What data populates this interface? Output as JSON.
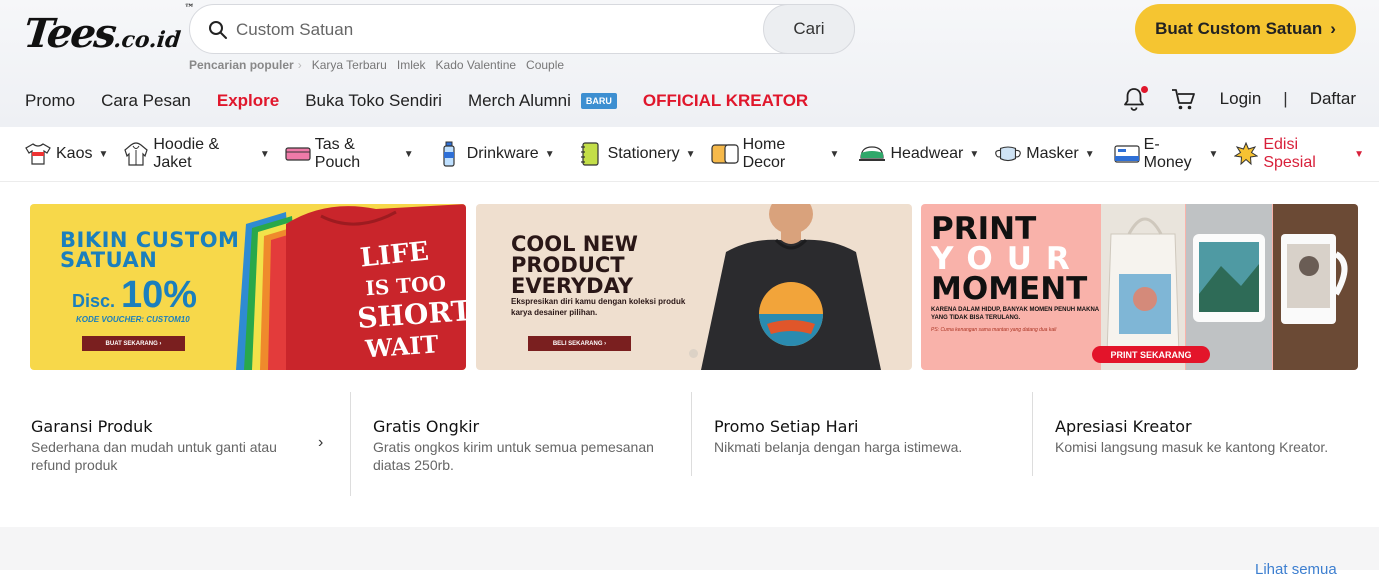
{
  "brand": {
    "logo_main": "Tees",
    "logo_suffix": ".co.id",
    "logo_tm": "™"
  },
  "search": {
    "placeholder": "Custom Satuan",
    "button": "Cari"
  },
  "popular": {
    "label": "Pencarian populer",
    "items": [
      "Karya Terbaru",
      "Imlek",
      "Kado Valentine",
      "Couple"
    ]
  },
  "cta": {
    "label": "Buat Custom Satuan",
    "arrow": "›"
  },
  "nav": {
    "items": [
      {
        "label": "Promo"
      },
      {
        "label": "Cara Pesan"
      },
      {
        "label": "Explore"
      },
      {
        "label": "Buka Toko Sendiri"
      },
      {
        "label": "Merch Alumni",
        "badge": "BARU"
      },
      {
        "label": "OFFICIAL KREATOR"
      }
    ],
    "login": "Login",
    "separator": "|",
    "register": "Daftar"
  },
  "categories": [
    {
      "label": "Kaos",
      "icon": "tshirt-icon"
    },
    {
      "label": "Hoodie & Jaket",
      "icon": "hoodie-icon"
    },
    {
      "label": "Tas & Pouch",
      "icon": "pouch-icon"
    },
    {
      "label": "Drinkware",
      "icon": "bottle-icon"
    },
    {
      "label": "Stationery",
      "icon": "notebook-icon"
    },
    {
      "label": "Home Decor",
      "icon": "pillow-icon"
    },
    {
      "label": "Headwear",
      "icon": "cap-icon"
    },
    {
      "label": "Masker",
      "icon": "mask-icon"
    },
    {
      "label": "E-Money",
      "icon": "card-icon"
    },
    {
      "label": "Edisi Spesial",
      "icon": "star-burst-icon"
    }
  ],
  "banners": {
    "b1": {
      "title_1": "BIKIN CUSTOM",
      "title_2": "SATUAN",
      "disc_label": "Disc.",
      "disc_value": "10%",
      "voucher": "KODE VOUCHER: CUSTOM10",
      "button": "BUAT SEKARANG ›",
      "shirt_text": "LIFE IS TOO SHORT TO WAIT"
    },
    "b2": {
      "title_1": "COOL NEW",
      "title_2": "PRODUCT",
      "title_3": "EVERYDAY",
      "sub": "Ekspresikan diri kamu dengan koleksi produk karya desainer pilihan.",
      "button": "BELI SEKARANG ›"
    },
    "b3": {
      "title_1": "PRINT",
      "title_2": "YOUR",
      "title_3": "MOMENT",
      "sub": "KARENA DALAM HIDUP, BANYAK MOMEN PENUH MAKNA YANG TIDAK BISA TERULANG.",
      "ps": "PS: Cuma kenangan sama mantan yang datang dua kali",
      "button": "PRINT SEKARANG"
    }
  },
  "features": [
    {
      "title": "Garansi Produk",
      "desc": "Sederhana dan mudah untuk ganti atau refund produk"
    },
    {
      "title": "Gratis Ongkir",
      "desc": "Gratis ongkos kirim untuk semua pemesanan diatas 250rb."
    },
    {
      "title": "Promo Setiap Hari",
      "desc": "Nikmati belanja dengan harga istimewa."
    },
    {
      "title": "Apresiasi Kreator",
      "desc": "Komisi langsung masuk ke kantong Kreator."
    }
  ],
  "feature_arrow": "›",
  "see_all": "Lihat semua",
  "colors": {
    "accent_yellow": "#f5c531",
    "brand_red": "#e0172c",
    "badge_blue": "#3d8fd1"
  }
}
